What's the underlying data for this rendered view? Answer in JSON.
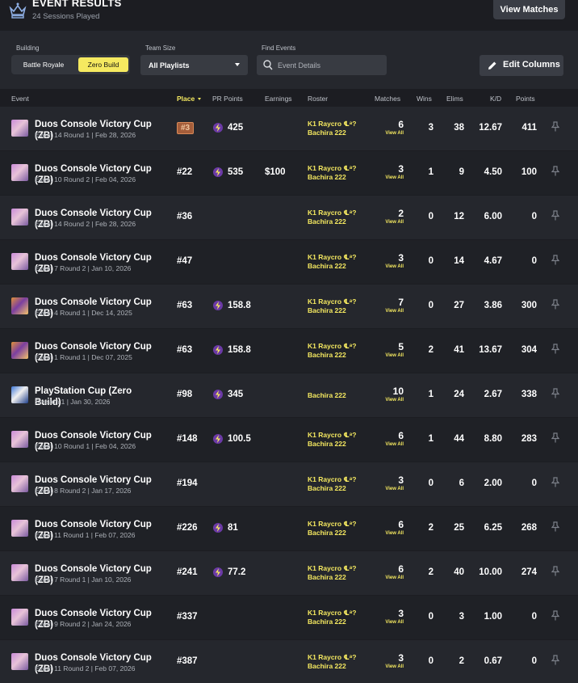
{
  "header": {
    "title": "EVENT RESULTS",
    "subtitle": "24 Sessions Played",
    "view_matches": "View Matches"
  },
  "filters": {
    "building_label": "Building",
    "building_options": [
      "Battle Royale",
      "Zero Build"
    ],
    "building_selected": "Zero Build",
    "team_size_label": "Team Size",
    "team_size_value": "All Playlists",
    "find_label": "Find Events",
    "find_placeholder": "Event Details",
    "edit_columns": "Edit Columns"
  },
  "columns": {
    "event": "Event",
    "place": "Place",
    "pr_points": "PR Points",
    "earnings": "Earnings",
    "roster": "Roster",
    "matches": "Matches",
    "wins": "Wins",
    "elims": "Elims",
    "kd": "K/D",
    "points": "Points"
  },
  "view_all_label": "View All",
  "colors": {
    "accent": "#f5e960",
    "row_bg": "#25272d",
    "row_alt_bg": "#1f2126",
    "badge_bg": "#a45d3a",
    "bolt": "#6b3aa6"
  },
  "rows": [
    {
      "thumb": "pink-skin",
      "name": "Duos Console Victory Cup (ZB)",
      "sub": "Event 14 Round 1 | Feb 28, 2026",
      "place": "#3",
      "place_badge": true,
      "pr": "425",
      "earnings": "",
      "roster": [
        "K1 Raycro ℄ᵃ?",
        "Bachira 222"
      ],
      "matches": "6",
      "wins": "3",
      "elims": "38",
      "kd": "12.67",
      "points": "411"
    },
    {
      "thumb": "pink-skin",
      "name": "Duos Console Victory Cup (ZB)",
      "sub": "Event 10 Round 2 | Feb 04, 2026",
      "place": "#22",
      "place_badge": false,
      "pr": "535",
      "earnings": "$100",
      "roster": [
        "K1 Raycro ℄ᵃ?",
        "Bachira 222"
      ],
      "matches": "3",
      "wins": "1",
      "elims": "9",
      "kd": "4.50",
      "points": "100"
    },
    {
      "thumb": "pink-skin",
      "name": "Duos Console Victory Cup (ZB)",
      "sub": "Event 14 Round 2 | Feb 28, 2026",
      "place": "#36",
      "place_badge": false,
      "pr": "",
      "earnings": "",
      "roster": [
        "K1 Raycro ℄ᵃ?",
        "Bachira 222"
      ],
      "matches": "2",
      "wins": "0",
      "elims": "12",
      "kd": "6.00",
      "points": "0"
    },
    {
      "thumb": "pink-skin",
      "name": "Duos Console Victory Cup (ZB)",
      "sub": "Event 7 Round 2 | Jan 10, 2026",
      "place": "#47",
      "place_badge": false,
      "pr": "",
      "earnings": "",
      "roster": [
        "K1 Raycro ℄ᵃ?",
        "Bachira 222"
      ],
      "matches": "3",
      "wins": "0",
      "elims": "14",
      "kd": "4.67",
      "points": "0"
    },
    {
      "thumb": "orange-skin",
      "name": "Duos Console Victory Cup (ZB)",
      "sub": "Event 4 Round 1 | Dec 14, 2025",
      "place": "#63",
      "place_badge": false,
      "pr": "158.8",
      "earnings": "",
      "roster": [
        "K1 Raycro ℄ᵃ?",
        "Bachira 222"
      ],
      "matches": "7",
      "wins": "0",
      "elims": "27",
      "kd": "3.86",
      "points": "300"
    },
    {
      "thumb": "orange-skin",
      "name": "Duos Console Victory Cup (ZB)",
      "sub": "Event 1 Round 1 | Dec 07, 2025",
      "place": "#63",
      "place_badge": false,
      "pr": "158.8",
      "earnings": "",
      "roster": [
        "K1 Raycro ℄ᵃ?",
        "Bachira 222"
      ],
      "matches": "5",
      "wins": "2",
      "elims": "41",
      "kd": "13.67",
      "points": "304"
    },
    {
      "thumb": "blue-skin",
      "name": "PlayStation Cup (Zero Build)",
      "sub": "Session 1 | Jan 30, 2026",
      "place": "#98",
      "place_badge": false,
      "pr": "345",
      "earnings": "",
      "roster": [
        "Bachira 222"
      ],
      "matches": "10",
      "wins": "1",
      "elims": "24",
      "kd": "2.67",
      "points": "338"
    },
    {
      "thumb": "pink-skin",
      "name": "Duos Console Victory Cup (ZB)",
      "sub": "Event 10 Round 1 | Feb 04, 2026",
      "place": "#148",
      "place_badge": false,
      "pr": "100.5",
      "earnings": "",
      "roster": [
        "K1 Raycro ℄ᵃ?",
        "Bachira 222"
      ],
      "matches": "6",
      "wins": "1",
      "elims": "44",
      "kd": "8.80",
      "points": "283"
    },
    {
      "thumb": "pink-skin",
      "name": "Duos Console Victory Cup (ZB)",
      "sub": "Event 8 Round 2 | Jan 17, 2026",
      "place": "#194",
      "place_badge": false,
      "pr": "",
      "earnings": "",
      "roster": [
        "K1 Raycro ℄ᵃ?",
        "Bachira 222"
      ],
      "matches": "3",
      "wins": "0",
      "elims": "6",
      "kd": "2.00",
      "points": "0"
    },
    {
      "thumb": "pink-skin",
      "name": "Duos Console Victory Cup (ZB)",
      "sub": "Event 11 Round 1 | Feb 07, 2026",
      "place": "#226",
      "place_badge": false,
      "pr": "81",
      "earnings": "",
      "roster": [
        "K1 Raycro ℄ᵃ?",
        "Bachira 222"
      ],
      "matches": "6",
      "wins": "2",
      "elims": "25",
      "kd": "6.25",
      "points": "268"
    },
    {
      "thumb": "pink-skin",
      "name": "Duos Console Victory Cup (ZB)",
      "sub": "Event 7 Round 1 | Jan 10, 2026",
      "place": "#241",
      "place_badge": false,
      "pr": "77.2",
      "earnings": "",
      "roster": [
        "K1 Raycro ℄ᵃ?",
        "Bachira 222"
      ],
      "matches": "6",
      "wins": "2",
      "elims": "40",
      "kd": "10.00",
      "points": "274"
    },
    {
      "thumb": "pink-skin",
      "name": "Duos Console Victory Cup (ZB)",
      "sub": "Event 9 Round 2 | Jan 24, 2026",
      "place": "#337",
      "place_badge": false,
      "pr": "",
      "earnings": "",
      "roster": [
        "K1 Raycro ℄ᵃ?",
        "Bachira 222"
      ],
      "matches": "3",
      "wins": "0",
      "elims": "3",
      "kd": "1.00",
      "points": "0"
    },
    {
      "thumb": "pink-skin",
      "name": "Duos Console Victory Cup (ZB)",
      "sub": "Event 11 Round 2 | Feb 07, 2026",
      "place": "#387",
      "place_badge": false,
      "pr": "",
      "earnings": "",
      "roster": [
        "K1 Raycro ℄ᵃ?",
        "Bachira 222"
      ],
      "matches": "3",
      "wins": "0",
      "elims": "2",
      "kd": "0.67",
      "points": "0"
    }
  ]
}
